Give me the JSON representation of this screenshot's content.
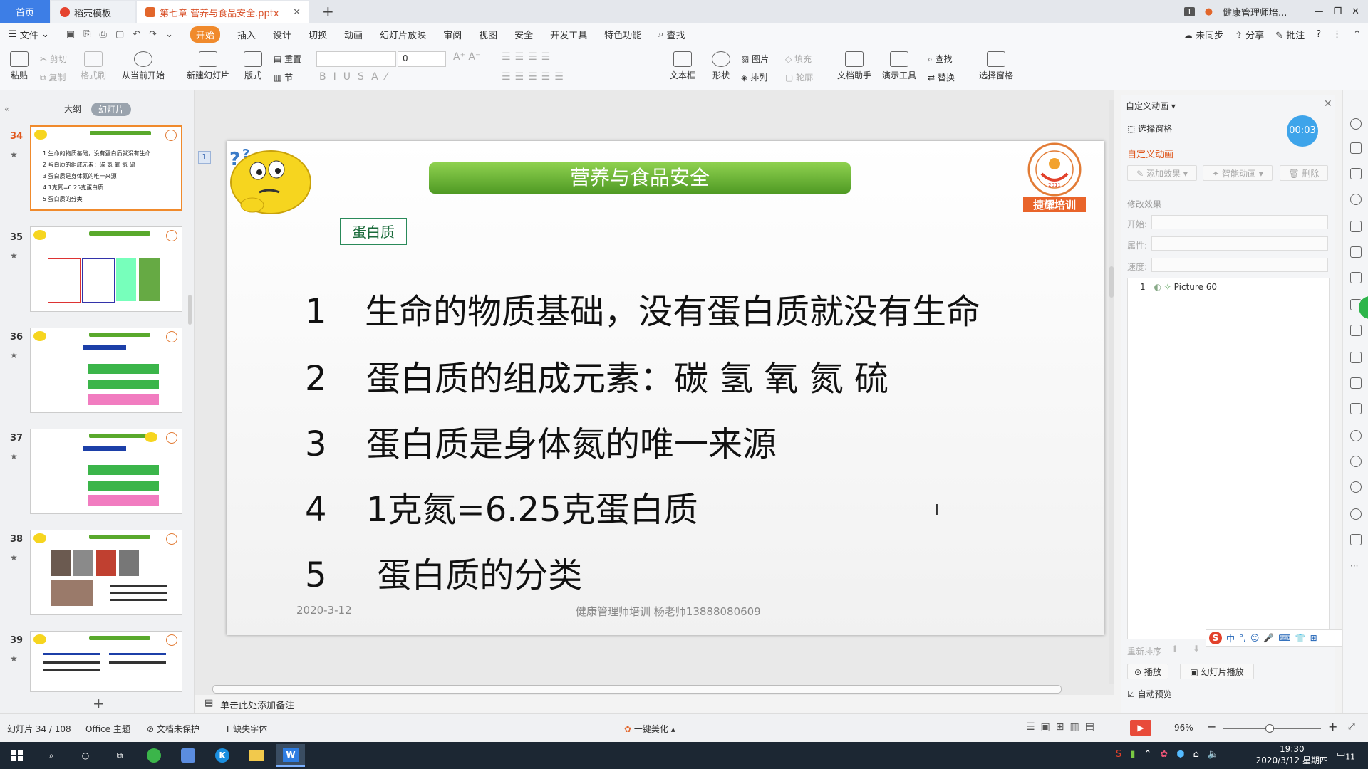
{
  "window": {
    "tabs": [
      {
        "label": "首页"
      },
      {
        "label": "稻壳模板"
      },
      {
        "label": "第七章 营养与食品安全.pptx"
      }
    ],
    "badge": "1",
    "user": "健康管理师培..."
  },
  "menu": {
    "file": "文件",
    "items": [
      "开始",
      "插入",
      "设计",
      "切换",
      "动画",
      "幻灯片放映",
      "审阅",
      "视图",
      "安全",
      "开发工具",
      "特色功能"
    ],
    "search": "查找",
    "right": [
      "未同步",
      "分享",
      "批注"
    ]
  },
  "ribbon": {
    "paste": "粘贴",
    "cut": "剪切",
    "copy": "复制",
    "format_painter": "格式刷",
    "play_from_current": "从当前开始",
    "new_slide": "新建幻灯片",
    "layout": "版式",
    "reset": "重置",
    "section": "节",
    "font_size": "0",
    "textbox": "文本框",
    "shape": "形状",
    "picture": "图片",
    "fill": "填充",
    "arrange": "排列",
    "outline": "轮廓",
    "doc_helper": "文档助手",
    "presentation_tools": "演示工具",
    "find": "查找",
    "replace": "替换",
    "selection_pane": "选择窗格"
  },
  "left_panel": {
    "tab_outline": "大纲",
    "tab_slides": "幻灯片",
    "thumbs": [
      {
        "num": "34",
        "lines": [
          "1  生命的物质基础，没有蛋白质就没有生命",
          "2  蛋白质的组成元素：碳 氢 氧 氮 硫",
          "3  蛋白质是身体氮的唯一来源",
          "4  1克氮=6.25克蛋白质",
          "5  蛋白质的分类"
        ]
      },
      {
        "num": "35"
      },
      {
        "num": "36"
      },
      {
        "num": "37"
      },
      {
        "num": "38"
      },
      {
        "num": "39"
      }
    ],
    "add": "+"
  },
  "slide": {
    "index": "1",
    "title": "营养与食品安全",
    "label": "蛋白质",
    "items": [
      {
        "n": "1",
        "text": "生命的物质基础，没有蛋白质就没有生命"
      },
      {
        "n": "2",
        "text": "蛋白质的组成元素：碳  氢   氧   氮   硫"
      },
      {
        "n": "3",
        "text": "蛋白质是身体氮的唯一来源"
      },
      {
        "n": "4",
        "text": "1克氮=6.25克蛋白质"
      },
      {
        "n": "5",
        "text": " 蛋白质的分类"
      }
    ],
    "date": "2020-3-12",
    "footer": "健康管理师培训 杨老师13888080609",
    "logo_text": "捷耀培训",
    "logo_year": "2011"
  },
  "notes": {
    "placeholder": "单击此处添加备注"
  },
  "right_panel": {
    "header": "自定义动画",
    "select_pane": "选择窗格",
    "timer": "00:03",
    "section_title": "自定义动画",
    "add_effect": "添加效果",
    "smart_anim": "智能动画",
    "delete": "删除",
    "modify": "修改效果",
    "start": "开始:",
    "property": "属性:",
    "speed": "速度:",
    "anim_item": {
      "num": "1",
      "name": "Picture 60"
    },
    "reorder": "重新排序",
    "play": "播放",
    "slideshow": "幻灯片播放",
    "autopreview": "自动预览"
  },
  "status": {
    "slide_pos": "幻灯片 34 / 108",
    "theme": "Office 主题",
    "protect": "文档未保护",
    "missing_font": "缺失字体",
    "beautify": "一键美化",
    "zoom": "96%"
  },
  "taskbar": {
    "time": "19:30",
    "date": "2020/3/12 星期四",
    "ime": "中",
    "notif": "11"
  },
  "colors": {
    "accent": "#f08a2c",
    "title_green": "#59a92c",
    "home_tab": "#3d7ee6"
  }
}
